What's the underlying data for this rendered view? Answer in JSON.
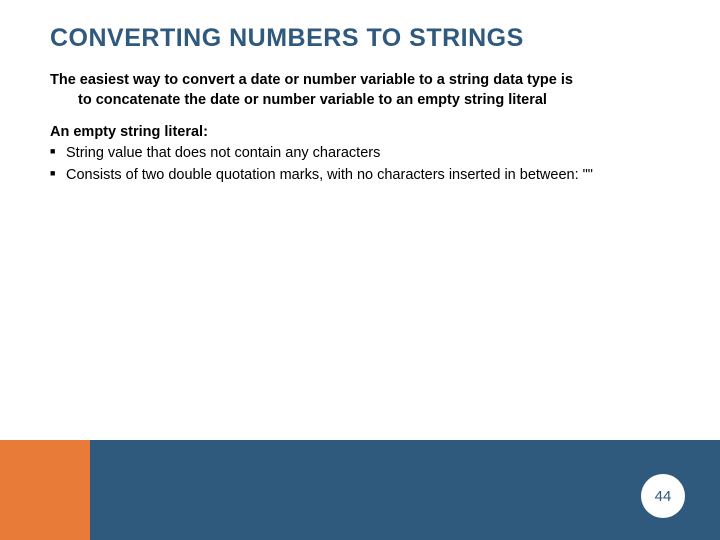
{
  "title": "CONVERTING NUMBERS TO STRINGS",
  "intro_line1": "The easiest way to convert a date or number variable to a string data type is",
  "intro_line2": "to concatenate the date or number variable to an empty string literal",
  "subhead": "An empty string literal:",
  "bullets": [
    "String value that does not contain any characters",
    "Consists of two double quotation marks, with no characters inserted in between: \"\""
  ],
  "page_number": "44",
  "colors": {
    "heading": "#30597e",
    "bar_orange": "#e77b37",
    "bar_blue": "#30597e"
  }
}
